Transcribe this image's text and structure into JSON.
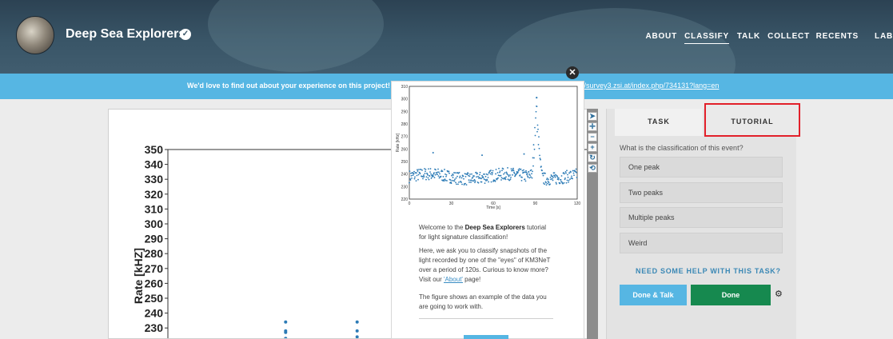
{
  "header": {
    "title": "Deep Sea Explorers",
    "nav": [
      "ABOUT",
      "CLASSIFY",
      "TALK",
      "COLLECT",
      "RECENTS",
      "LAB"
    ]
  },
  "banner": {
    "text": "We'd love to find out about your experience on this project! P",
    "link": "//survey3.zsi.at/index.php/734131?lang=en"
  },
  "colors": {
    "header": "#395567",
    "banner": "#56b6e3",
    "accent_blue": "#56b6e3",
    "done_green": "#16894f",
    "highlight_red": "#e2202a",
    "data_blue": "#2c7bb6"
  },
  "task": {
    "tabs": [
      "TASK",
      "TUTORIAL"
    ],
    "question": "What is the classification of this event?",
    "answers": [
      "One peak",
      "Two peaks",
      "Multiple peaks",
      "Weird"
    ],
    "help": "NEED SOME HELP WITH THIS TASK?",
    "done_talk": "Done & Talk",
    "done": "Done"
  },
  "toolbar": {
    "icons": [
      "pointer-icon",
      "move-icon",
      "zoom-out-icon",
      "zoom-in-icon",
      "rotate-icon",
      "reset-icon"
    ]
  },
  "tutorial": {
    "welcome_pre": "Welcome to the ",
    "welcome_bold": "Deep Sea Explorers",
    "welcome_post": " tutorial for light signature classification!",
    "intro": "Here, we ask you to classify snapshots of the light recorded by one of the \"eyes\" of KM3NeT over a period of 120s. Curious to know more? Visit our ",
    "about_link": "'About'",
    "intro_end": " page!",
    "figure_note": "The figure shows an example of the data you are going to work with."
  },
  "chart_data": [
    {
      "type": "scatter",
      "title": "",
      "xlabel": "",
      "ylabel": "Rate [kHZ]",
      "y_ticks": [
        350,
        340,
        330,
        320,
        310,
        300,
        290,
        280,
        270,
        260,
        250,
        240,
        230
      ],
      "ylim": [
        220,
        350
      ],
      "series": [
        {
          "x": [
            0.28,
            0.28,
            0.28,
            0.28,
            0.45,
            0.45,
            0.45
          ],
          "y": [
            234,
            228,
            227,
            223,
            234,
            228,
            224
          ]
        }
      ]
    },
    {
      "type": "scatter",
      "title": "",
      "xlabel": "Time [s]",
      "ylabel": "Rate [kHz]",
      "x_ticks": [
        0,
        30,
        60,
        90,
        120
      ],
      "y_ticks": [
        220,
        230,
        240,
        250,
        260,
        270,
        280,
        290,
        300,
        310
      ],
      "xlim": [
        0,
        120
      ],
      "ylim": [
        220,
        310
      ],
      "peak": {
        "x": 91,
        "y": 301
      },
      "baseline_y": 238,
      "outliers": [
        {
          "x": 17,
          "y": 257
        },
        {
          "x": 52,
          "y": 255
        },
        {
          "x": 82,
          "y": 256
        }
      ]
    }
  ]
}
